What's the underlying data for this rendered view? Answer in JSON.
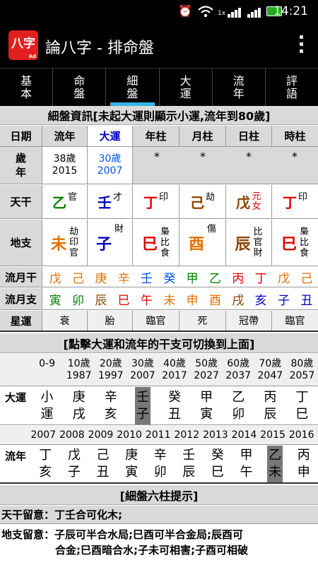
{
  "status": {
    "time": "14:21",
    "network": "1x"
  },
  "app": {
    "logo": "八字",
    "logo_sub": "Ad",
    "title": "論八字 - 排命盤"
  },
  "tabs": [
    "基本",
    "命盤",
    "細盤",
    "大運",
    "流年",
    "評語"
  ],
  "active_tab": 2,
  "section1_title": "細盤資訊[未起大運則顯示小運,流年到80歲]",
  "col_headers": [
    "日期",
    "流年",
    "大運",
    "年柱",
    "月柱",
    "日柱",
    "時柱"
  ],
  "age_row": {
    "label": "歲年",
    "liunian_age": "38歲",
    "liunian_year": "2015",
    "dayun_age": "30歲",
    "dayun_year": "2007",
    "pillars": [
      "*",
      "*",
      "*",
      "*"
    ]
  },
  "tiangan": {
    "label": "天干",
    "cells": [
      {
        "char": "乙",
        "note": "官",
        "color": "#008000"
      },
      {
        "char": "壬",
        "note": "才",
        "color": "#0000c0"
      },
      {
        "char": "丁",
        "note": "印",
        "color": "#e00000"
      },
      {
        "char": "己",
        "note": "劫",
        "color": "#8b4500"
      },
      {
        "char": "戊",
        "note": "元女",
        "color": "#8b4500"
      },
      {
        "char": "丁",
        "note": "印",
        "color": "#e00000"
      }
    ]
  },
  "dizhi": {
    "label": "地支",
    "cells": [
      {
        "char": "未",
        "notes": [
          "劫",
          "印",
          "官"
        ],
        "color": "#e07000"
      },
      {
        "char": "子",
        "notes": [
          "財"
        ],
        "color": "#0000c0"
      },
      {
        "char": "巳",
        "notes": [
          "梟",
          "比",
          "食"
        ],
        "color": "#e00000"
      },
      {
        "char": "酉",
        "notes": [
          "傷"
        ],
        "color": "#e07000"
      },
      {
        "char": "辰",
        "notes": [
          "比",
          "官",
          "財"
        ],
        "color": "#8b4500"
      },
      {
        "char": "巳",
        "notes": [
          "梟",
          "比",
          "食"
        ],
        "color": "#e00000"
      }
    ]
  },
  "liuyue_gan": {
    "label": "流月干",
    "chars": [
      {
        "c": "戊",
        "color": "#e07000"
      },
      {
        "c": "己",
        "color": "#e07000"
      },
      {
        "c": "庚",
        "color": "#e07000"
      },
      {
        "c": "辛",
        "color": "#e07000"
      },
      {
        "c": "壬",
        "color": "#0055dd"
      },
      {
        "c": "癸",
        "color": "#0055dd"
      },
      {
        "c": "甲",
        "color": "#008000"
      },
      {
        "c": "乙",
        "color": "#008000"
      },
      {
        "c": "丙",
        "color": "#e00000"
      },
      {
        "c": "丁",
        "color": "#e00000"
      },
      {
        "c": "戊",
        "color": "#e07000"
      },
      {
        "c": "己",
        "color": "#e07000"
      }
    ]
  },
  "liuyue_zhi": {
    "label": "流月支",
    "chars": [
      {
        "c": "寅",
        "color": "#008000"
      },
      {
        "c": "卯",
        "color": "#008000"
      },
      {
        "c": "辰",
        "color": "#8b4500"
      },
      {
        "c": "巳",
        "color": "#e00000"
      },
      {
        "c": "午",
        "color": "#e00000"
      },
      {
        "c": "未",
        "color": "#e07000"
      },
      {
        "c": "申",
        "color": "#e07000"
      },
      {
        "c": "酉",
        "color": "#e07000"
      },
      {
        "c": "戌",
        "color": "#8b4500"
      },
      {
        "c": "亥",
        "color": "#0000c0"
      },
      {
        "c": "子",
        "color": "#0000c0"
      },
      {
        "c": "丑",
        "color": "#0000c0"
      }
    ]
  },
  "xingyun": {
    "label": "星運",
    "values": [
      "衰",
      "胎",
      "臨官",
      "死",
      "冠帶",
      "臨官"
    ]
  },
  "section2_title": "[點擊大運和流年的干支可切換到上面]",
  "dayun_ages": [
    "0-9",
    "10歲",
    "20歲",
    "30歲",
    "40歲",
    "50歲",
    "60歲",
    "70歲",
    "80歲"
  ],
  "dayun_years": [
    "",
    "1987",
    "1997",
    "2007",
    "2017",
    "2027",
    "2037",
    "2047",
    "2057"
  ],
  "dayun": {
    "label": "大運",
    "items": [
      {
        "gan": "小",
        "zhi": "運"
      },
      {
        "gan": "庚",
        "zhi": "戌"
      },
      {
        "gan": "辛",
        "zhi": "亥"
      },
      {
        "gan": "壬",
        "zhi": "子"
      },
      {
        "gan": "癸",
        "zhi": "丑"
      },
      {
        "gan": "甲",
        "zhi": "寅"
      },
      {
        "gan": "乙",
        "zhi": "卯"
      },
      {
        "gan": "丙",
        "zhi": "辰"
      },
      {
        "gan": "丁",
        "zhi": "巳"
      }
    ],
    "selected": 3
  },
  "liunian_years": [
    "2007",
    "2008",
    "2009",
    "2010",
    "2011",
    "2012",
    "2013",
    "2014",
    "2015",
    "2016"
  ],
  "liunian": {
    "label": "流年",
    "items": [
      {
        "gan": "丁",
        "zhi": "亥"
      },
      {
        "gan": "戊",
        "zhi": "子"
      },
      {
        "gan": "己",
        "zhi": "丑"
      },
      {
        "gan": "庚",
        "zhi": "寅"
      },
      {
        "gan": "辛",
        "zhi": "卯"
      },
      {
        "gan": "壬",
        "zhi": "辰"
      },
      {
        "gan": "癸",
        "zhi": "巳"
      },
      {
        "gan": "甲",
        "zhi": "午"
      },
      {
        "gan": "乙",
        "zhi": "未"
      },
      {
        "gan": "丙",
        "zhi": "申"
      }
    ],
    "selected": 8
  },
  "section3_title": "[細盤六柱提示]",
  "tip_tiangan": "天干留意：丁壬合可化木;",
  "tip_dizhi_1": "地支留意：子辰可半合水局;巳酉可半合金局;辰酉可",
  "tip_dizhi_2": "合金;巳酉暗合水;子未可相害;子酉可相破"
}
